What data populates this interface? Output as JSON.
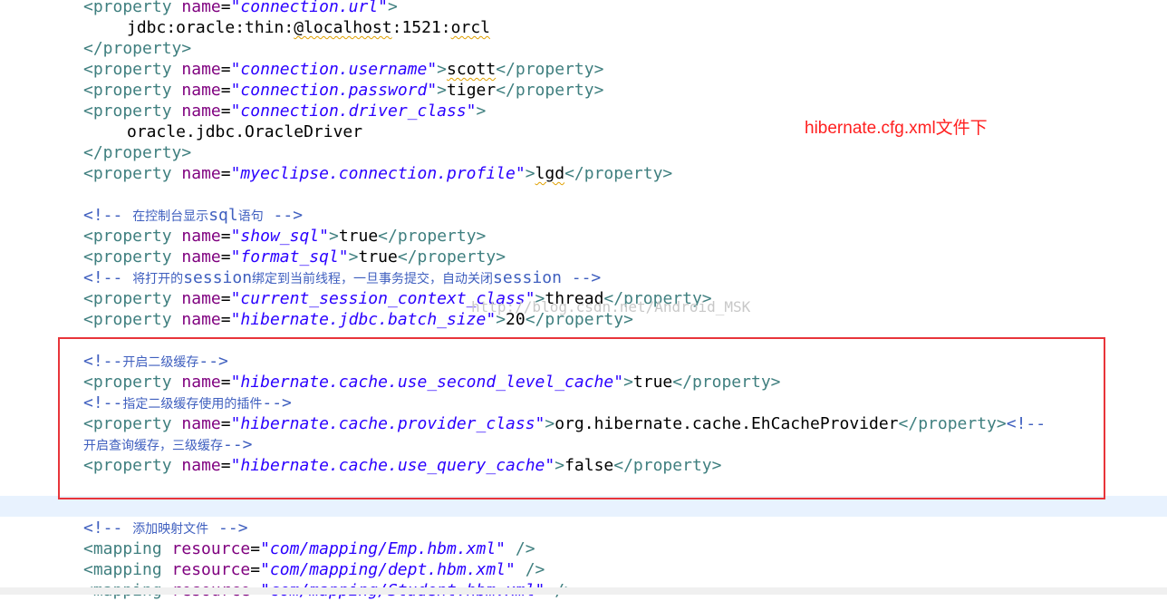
{
  "note": "hibernate.cfg.xml文件下",
  "watermark": "http://blog.csdn.net/Android_MSK",
  "lines": [
    {
      "top": 0,
      "open": "<property ",
      "attr": "name",
      "value": "\"connection.url\"",
      "close": ">",
      "text": ""
    },
    {
      "top": 0,
      "text": "jdbc:oracle:thin:@localhost:1521:orcl"
    },
    {
      "top": 0,
      "end": "</property>"
    },
    {
      "attr": "name",
      "value": "\"connection.username\"",
      "text": "scott"
    },
    {
      "attr": "name",
      "value": "\"connection.password\"",
      "text": "tiger"
    },
    {
      "attr": "name",
      "value": "\"connection.driver_class\""
    },
    {
      "text": "oracle.jdbc.OracleDriver"
    },
    {
      "end": "</property>"
    },
    {
      "attr": "name",
      "value": "\"myeclipse.connection.profile\"",
      "text": "lgd"
    }
  ],
  "tags": {
    "open": "<property",
    "open_close": ">",
    "close": "</property>",
    "attr_name": "name",
    "eq": "="
  },
  "code": {
    "l1_val": "\"connection.url\"",
    "l2_text": "jdbc:oracle:thin:@localhost:1521:orcl",
    "l4_val": "\"connection.username\"",
    "l4_text": "scott",
    "l5_val": "\"connection.password\"",
    "l5_text": "tiger",
    "l6_val": "\"connection.driver_class\"",
    "l7_text": "oracle.jdbc.OracleDriver",
    "l9_val": "\"myeclipse.connection.profile\"",
    "l9_text": "lgd",
    "c1_open": "<!-- ",
    "c1_text": "在控制台显示",
    "c1_sql": "sql",
    "c1_text2": "语句",
    "c1_close": " -->",
    "l12_val": "\"show_sql\"",
    "l12_text": "true",
    "l13_val": "\"format_sql\"",
    "l13_text": "true",
    "c2_open": "<!-- ",
    "c2_text": "将打开的",
    "c2_session": "session",
    "c2_text2": "绑定到当前线程，一旦事务提交，自动关闭",
    "c2_session2": "session",
    "c2_close": " -->",
    "l15_val": "\"current_session_context_class\"",
    "l15_text": "thread",
    "l16_val": "\"hibernate.jdbc.batch_size\"",
    "l16_text": "20",
    "c3_open": "<!--",
    "c3_text": "开启二级缓存",
    "c3_close": "-->",
    "l19_val": "\"hibernate.cache.use_second_level_cache\"",
    "l19_text": "true",
    "c4_open": "<!--",
    "c4_text": "指定二级缓存使用的插件",
    "c4_close": "-->",
    "l21_val": "\"hibernate.cache.provider_class\"",
    "l21_text": "org.hibernate.cache.EhCacheProvider",
    "l21_trail": "<!--",
    "c5_text": "开启查询缓存，三级缓存",
    "c5_close": "-->",
    "l23_val": "\"hibernate.cache.use_query_cache\"",
    "l23_text": "false",
    "c6_open": "<!-- ",
    "c6_text": "添加映射文件",
    "c6_close": " -->",
    "map_tag": "<mapping",
    "map_attr": "resource",
    "map_end": " />",
    "m1_val": "\"com/mapping/Emp.hbm.xml\"",
    "m2_val": "\"com/mapping/dept.hbm.xml\"",
    "m3_val": "\"com/mapping/Student.hbm.xml\""
  }
}
